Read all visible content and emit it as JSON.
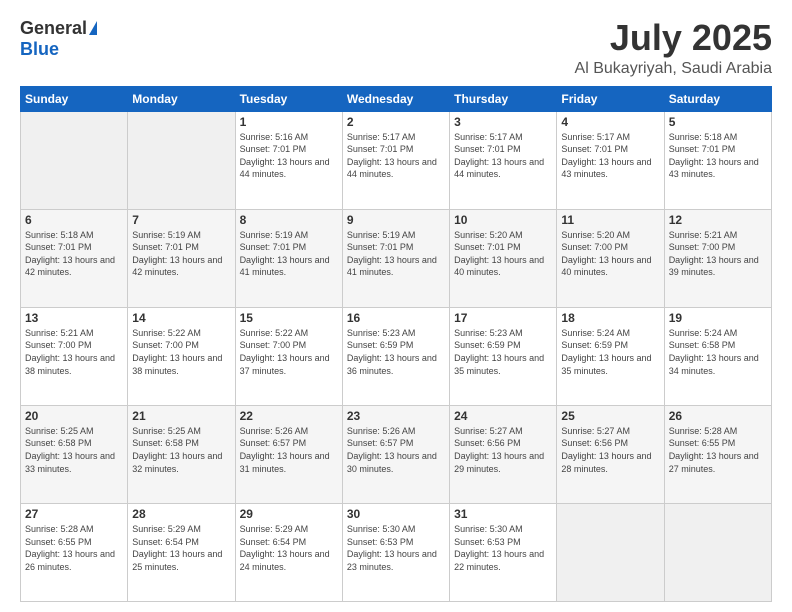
{
  "logo": {
    "general": "General",
    "blue": "Blue"
  },
  "title": {
    "month": "July 2025",
    "location": "Al Bukayriyah, Saudi Arabia"
  },
  "weekdays": [
    "Sunday",
    "Monday",
    "Tuesday",
    "Wednesday",
    "Thursday",
    "Friday",
    "Saturday"
  ],
  "weeks": [
    [
      {
        "day": "",
        "empty": true
      },
      {
        "day": "",
        "empty": true
      },
      {
        "day": "1",
        "sunrise": "5:16 AM",
        "sunset": "7:01 PM",
        "daylight": "13 hours and 44 minutes."
      },
      {
        "day": "2",
        "sunrise": "5:17 AM",
        "sunset": "7:01 PM",
        "daylight": "13 hours and 44 minutes."
      },
      {
        "day": "3",
        "sunrise": "5:17 AM",
        "sunset": "7:01 PM",
        "daylight": "13 hours and 44 minutes."
      },
      {
        "day": "4",
        "sunrise": "5:17 AM",
        "sunset": "7:01 PM",
        "daylight": "13 hours and 43 minutes."
      },
      {
        "day": "5",
        "sunrise": "5:18 AM",
        "sunset": "7:01 PM",
        "daylight": "13 hours and 43 minutes."
      }
    ],
    [
      {
        "day": "6",
        "sunrise": "5:18 AM",
        "sunset": "7:01 PM",
        "daylight": "13 hours and 42 minutes."
      },
      {
        "day": "7",
        "sunrise": "5:19 AM",
        "sunset": "7:01 PM",
        "daylight": "13 hours and 42 minutes."
      },
      {
        "day": "8",
        "sunrise": "5:19 AM",
        "sunset": "7:01 PM",
        "daylight": "13 hours and 41 minutes."
      },
      {
        "day": "9",
        "sunrise": "5:19 AM",
        "sunset": "7:01 PM",
        "daylight": "13 hours and 41 minutes."
      },
      {
        "day": "10",
        "sunrise": "5:20 AM",
        "sunset": "7:01 PM",
        "daylight": "13 hours and 40 minutes."
      },
      {
        "day": "11",
        "sunrise": "5:20 AM",
        "sunset": "7:00 PM",
        "daylight": "13 hours and 40 minutes."
      },
      {
        "day": "12",
        "sunrise": "5:21 AM",
        "sunset": "7:00 PM",
        "daylight": "13 hours and 39 minutes."
      }
    ],
    [
      {
        "day": "13",
        "sunrise": "5:21 AM",
        "sunset": "7:00 PM",
        "daylight": "13 hours and 38 minutes."
      },
      {
        "day": "14",
        "sunrise": "5:22 AM",
        "sunset": "7:00 PM",
        "daylight": "13 hours and 38 minutes."
      },
      {
        "day": "15",
        "sunrise": "5:22 AM",
        "sunset": "7:00 PM",
        "daylight": "13 hours and 37 minutes."
      },
      {
        "day": "16",
        "sunrise": "5:23 AM",
        "sunset": "6:59 PM",
        "daylight": "13 hours and 36 minutes."
      },
      {
        "day": "17",
        "sunrise": "5:23 AM",
        "sunset": "6:59 PM",
        "daylight": "13 hours and 35 minutes."
      },
      {
        "day": "18",
        "sunrise": "5:24 AM",
        "sunset": "6:59 PM",
        "daylight": "13 hours and 35 minutes."
      },
      {
        "day": "19",
        "sunrise": "5:24 AM",
        "sunset": "6:58 PM",
        "daylight": "13 hours and 34 minutes."
      }
    ],
    [
      {
        "day": "20",
        "sunrise": "5:25 AM",
        "sunset": "6:58 PM",
        "daylight": "13 hours and 33 minutes."
      },
      {
        "day": "21",
        "sunrise": "5:25 AM",
        "sunset": "6:58 PM",
        "daylight": "13 hours and 32 minutes."
      },
      {
        "day": "22",
        "sunrise": "5:26 AM",
        "sunset": "6:57 PM",
        "daylight": "13 hours and 31 minutes."
      },
      {
        "day": "23",
        "sunrise": "5:26 AM",
        "sunset": "6:57 PM",
        "daylight": "13 hours and 30 minutes."
      },
      {
        "day": "24",
        "sunrise": "5:27 AM",
        "sunset": "6:56 PM",
        "daylight": "13 hours and 29 minutes."
      },
      {
        "day": "25",
        "sunrise": "5:27 AM",
        "sunset": "6:56 PM",
        "daylight": "13 hours and 28 minutes."
      },
      {
        "day": "26",
        "sunrise": "5:28 AM",
        "sunset": "6:55 PM",
        "daylight": "13 hours and 27 minutes."
      }
    ],
    [
      {
        "day": "27",
        "sunrise": "5:28 AM",
        "sunset": "6:55 PM",
        "daylight": "13 hours and 26 minutes."
      },
      {
        "day": "28",
        "sunrise": "5:29 AM",
        "sunset": "6:54 PM",
        "daylight": "13 hours and 25 minutes."
      },
      {
        "day": "29",
        "sunrise": "5:29 AM",
        "sunset": "6:54 PM",
        "daylight": "13 hours and 24 minutes."
      },
      {
        "day": "30",
        "sunrise": "5:30 AM",
        "sunset": "6:53 PM",
        "daylight": "13 hours and 23 minutes."
      },
      {
        "day": "31",
        "sunrise": "5:30 AM",
        "sunset": "6:53 PM",
        "daylight": "13 hours and 22 minutes."
      },
      {
        "day": "",
        "empty": true
      },
      {
        "day": "",
        "empty": true
      }
    ]
  ]
}
